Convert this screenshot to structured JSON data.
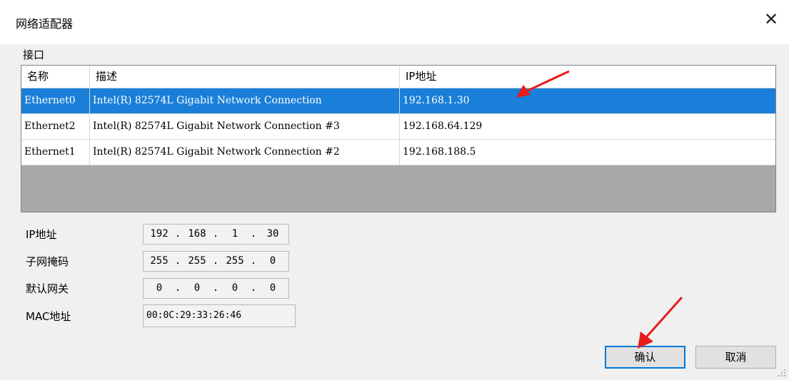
{
  "dialog": {
    "title": "网络适配器",
    "close_label": "✕"
  },
  "interface": {
    "section_label": "接口",
    "columns": [
      "名称",
      "描述",
      "IP地址"
    ],
    "rows": [
      {
        "name": "Ethernet0",
        "description": "Intel(R) 82574L Gigabit Network Connection",
        "ip": "192.168.1.30",
        "selected": true
      },
      {
        "name": "Ethernet2",
        "description": "Intel(R) 82574L Gigabit Network Connection #3",
        "ip": "192.168.64.129",
        "selected": false
      },
      {
        "name": "Ethernet1",
        "description": "Intel(R) 82574L Gigabit Network Connection #2",
        "ip": "192.168.188.5",
        "selected": false
      }
    ]
  },
  "fields": {
    "ip_label": "IP地址",
    "ip": [
      "192",
      "168",
      "1",
      "30"
    ],
    "subnet_label": "子网掩码",
    "subnet": [
      "255",
      "255",
      "255",
      "0"
    ],
    "gateway_label": "默认网关",
    "gateway": [
      "0",
      "0",
      "0",
      "0"
    ],
    "mac_label": "MAC地址",
    "mac": "00:0C:29:33:26:46"
  },
  "buttons": {
    "ok": "确认",
    "cancel": "取消"
  },
  "annotation": {
    "arrow_color": "#e81b1b"
  },
  "colors": {
    "selection": "#1a7fd8",
    "primary_border": "#0078d7"
  }
}
